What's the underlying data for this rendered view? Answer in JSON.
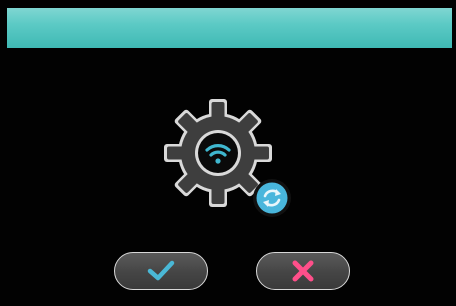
{
  "screen": {
    "header": {
      "title": ""
    },
    "icon": {
      "name": "wifi-settings-gear-icon",
      "badge": "refresh-icon",
      "wifi_color": "#3fb7cf",
      "badge_color": "#49b6dc"
    },
    "buttons": {
      "confirm": {
        "icon": "check-icon",
        "color": "#4ab8d6"
      },
      "cancel": {
        "icon": "close-icon",
        "color": "#ff4f8a"
      }
    }
  }
}
